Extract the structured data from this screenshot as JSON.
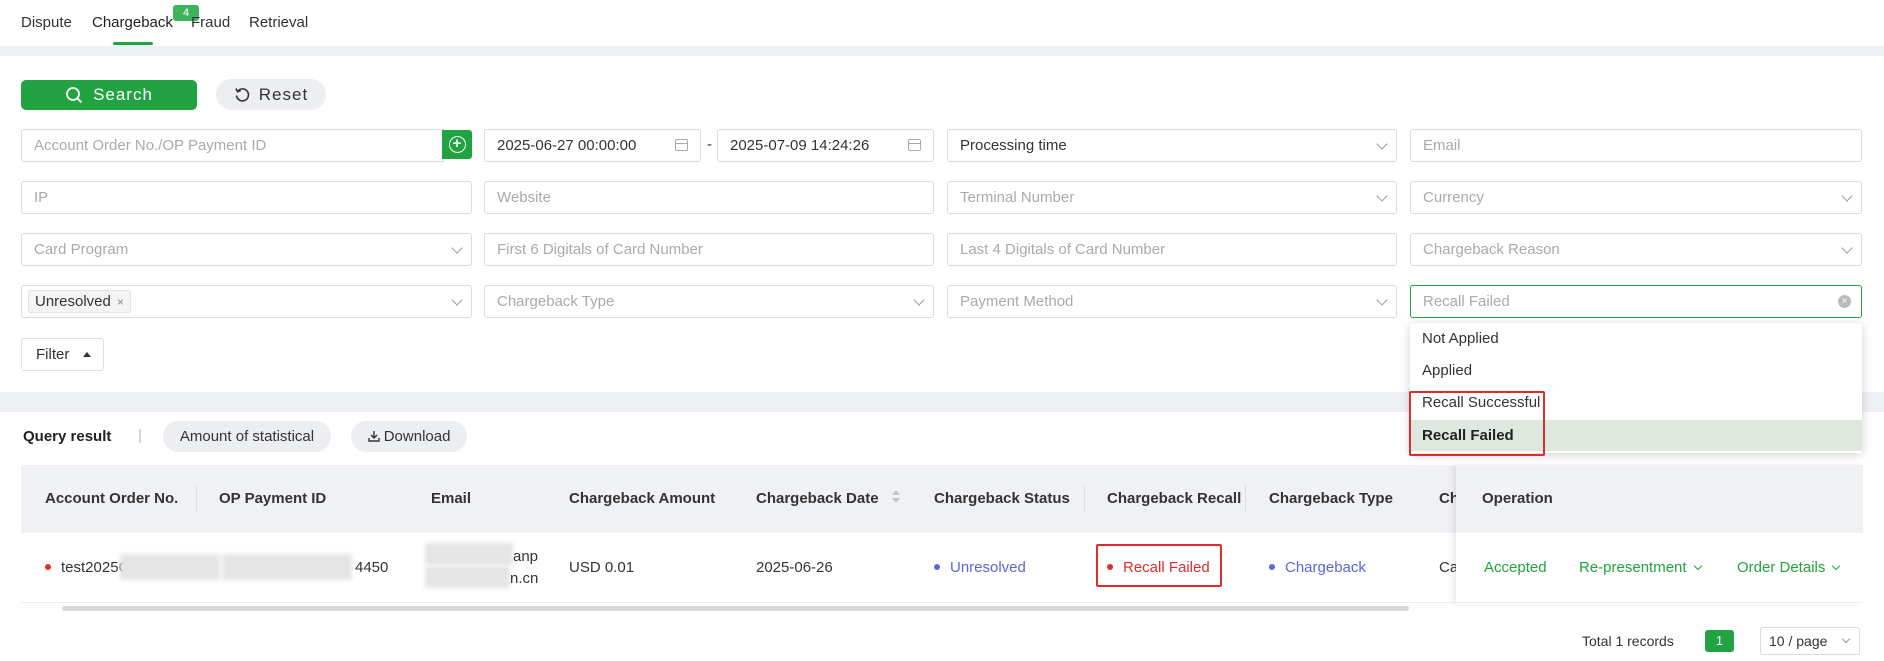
{
  "tabs": [
    {
      "label": "Dispute"
    },
    {
      "label": "Chargeback",
      "badge": "4"
    },
    {
      "label": "Fraud"
    },
    {
      "label": "Retrieval"
    }
  ],
  "actions": {
    "search": "Search",
    "reset": "Reset",
    "filter": "Filter"
  },
  "filters": {
    "order_placeholder": "Account Order No./OP Payment ID",
    "date_start": "2025-06-27 00:00:00",
    "date_sep": "-",
    "date_end": "2025-07-09 14:24:26",
    "time_type": "Processing time",
    "email": "Email",
    "ip": "IP",
    "website": "Website",
    "terminal": "Terminal Number",
    "currency": "Currency",
    "card_program": "Card Program",
    "first6": "First 6 Digitals of Card Number",
    "last4": "Last 4 Digitals of Card Number",
    "reason": "Chargeback Reason",
    "status_tag": "Unresolved",
    "status_tag_close": "×",
    "chargeback_type": "Chargeback Type",
    "payment_method": "Payment Method",
    "recall_placeholder": "Recall Failed",
    "clear": "×"
  },
  "recall_dropdown": {
    "options": [
      "Not Applied",
      "Applied",
      "Recall Successful",
      "Recall Failed"
    ],
    "selected": "Recall Failed"
  },
  "results": {
    "title": "Query result",
    "separator": "|",
    "amount_button": "Amount of statistical",
    "download_button": "Download"
  },
  "table": {
    "headers": [
      "Account Order No.",
      "OP Payment ID",
      "Email",
      "Chargeback Amount",
      "Chargeback Date",
      "Chargeback Status",
      "Chargeback Recall",
      "Chargeback Type",
      "Ch",
      "Operation"
    ],
    "row": {
      "order_no": "test2025C",
      "payment_id_suffix": "4450",
      "email_line1": "anp",
      "email_line2": "n.cn",
      "amount": "USD 0.01",
      "date": "2025-06-26",
      "status": "Unresolved",
      "recall": "Recall Failed",
      "type": "Chargeback",
      "channel": "Ca",
      "op_accepted": "Accepted",
      "op_represent": "Re-presentment",
      "op_details": "Order Details"
    }
  },
  "pagination": {
    "total": "Total 1 records",
    "page": "1",
    "page_size": "10 / page"
  },
  "colors": {
    "primary": "#22a341",
    "danger": "#e02c2c",
    "status_blue": "#5b66d8"
  }
}
